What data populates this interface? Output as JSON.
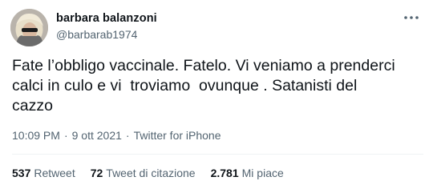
{
  "author": {
    "display_name": "barbara balanzoni",
    "handle": "@barbarab1974"
  },
  "icons": {
    "more": "more-horizontal-icon",
    "avatar": "user-photo"
  },
  "tweet": {
    "text": "Fate l’obbligo vaccinale. Fatelo. Vi veniamo a prenderci\ncalci in culo e vi  troviamo  ovunque . Satanisti del\ncazzo"
  },
  "meta": {
    "time": "10:09 PM",
    "separator": "·",
    "date": "9 ott 2021",
    "source": "Twitter for iPhone"
  },
  "stats": [
    {
      "count": "537",
      "label": "Retweet"
    },
    {
      "count": "72",
      "label": "Tweet di citazione"
    },
    {
      "count": "2.781",
      "label": "Mi piace"
    }
  ],
  "colors": {
    "text_primary": "#0f1419",
    "text_secondary": "#536471",
    "divider": "#eff3f4"
  }
}
